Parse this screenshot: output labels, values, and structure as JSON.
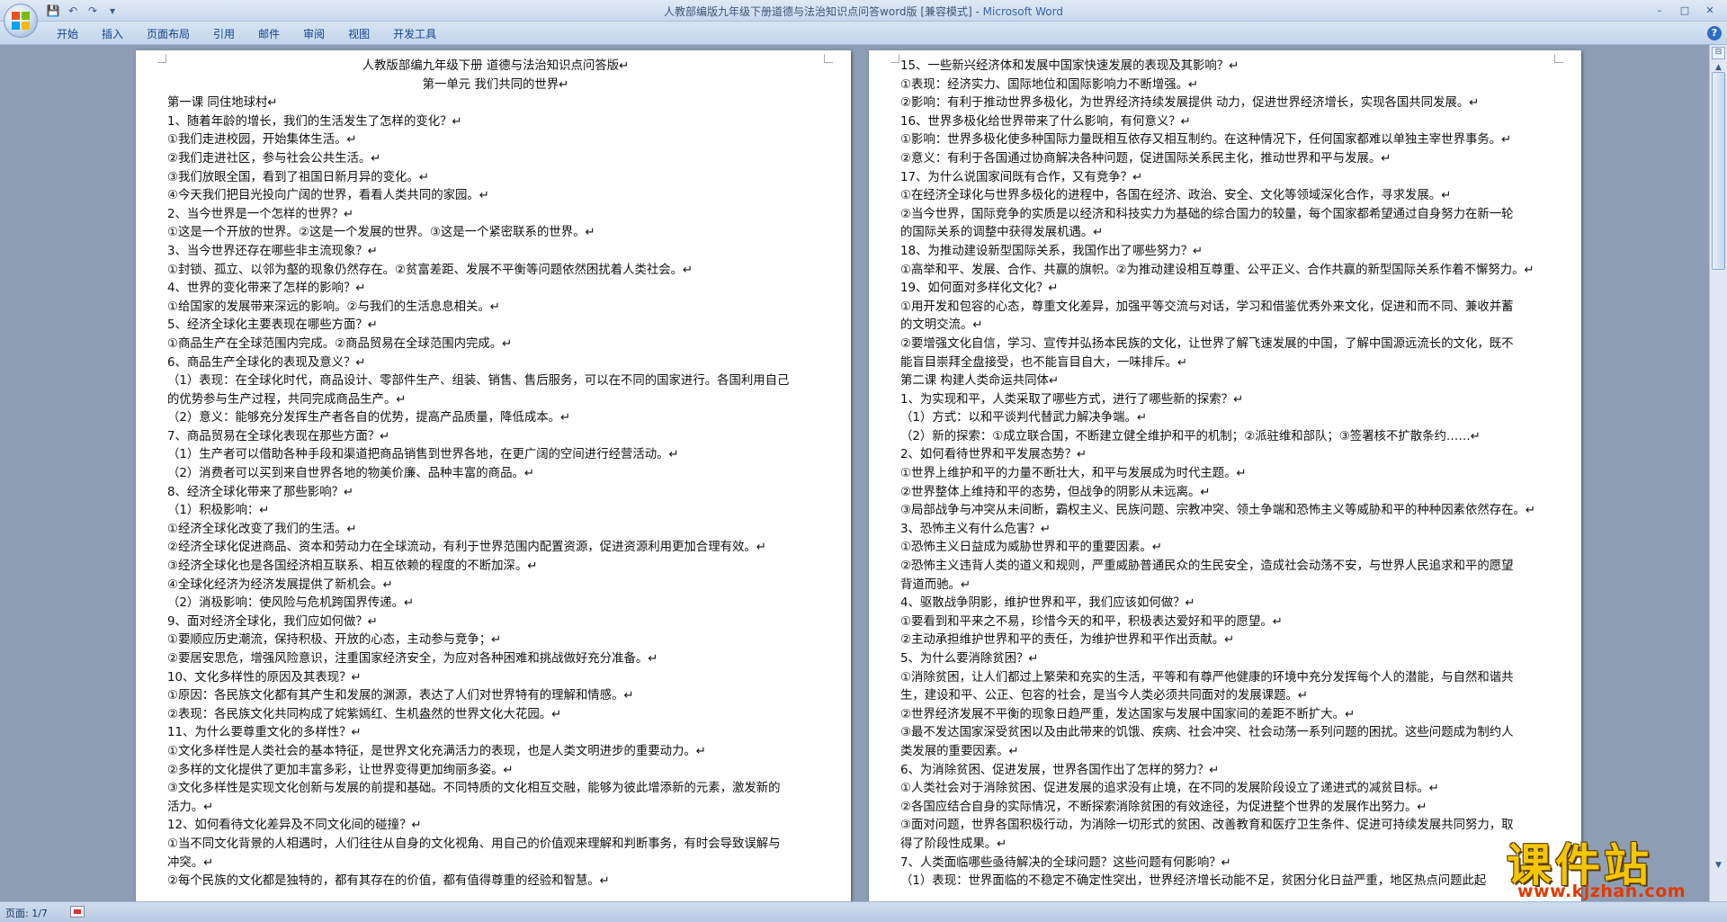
{
  "window": {
    "title": "人教部编版九年级下册道德与法治知识点问答word版 [兼容模式] - ",
    "app_name": "Microsoft Word",
    "minimize": "–",
    "maximize": "□",
    "close": "✕"
  },
  "qat": {
    "save": "💾",
    "undo": "↶",
    "redo": "↷",
    "customize": "▾"
  },
  "ribbon": {
    "tabs": [
      "开始",
      "插入",
      "页面布局",
      "引用",
      "邮件",
      "审阅",
      "视图",
      "开发工具"
    ],
    "help": "?"
  },
  "pages": {
    "left": [
      {
        "t": "人教版部编九年级下册 道德与法治知识点问答版↵",
        "c": true
      },
      {
        "t": "第一单元    我们共同的世界↵",
        "c": true
      },
      {
        "t": "第一课  同住地球村↵"
      },
      {
        "t": "1、随着年龄的增长，我们的生活发生了怎样的变化？↵"
      },
      {
        "t": "①我们走进校园，开始集体生活。↵"
      },
      {
        "t": "②我们走进社区，参与社会公共生活。↵"
      },
      {
        "t": "③我们放眼全国，看到了祖国日新月异的变化。↵"
      },
      {
        "t": "④今天我们把目光投向广阔的世界，看看人类共同的家园。↵"
      },
      {
        "t": "2、当今世界是一个怎样的世界？↵"
      },
      {
        "t": "①这是一个开放的世界。②这是一个发展的世界。③这是一个紧密联系的世界。↵"
      },
      {
        "t": "3、当今世界还存在哪些非主流现象？↵"
      },
      {
        "t": "①封锁、孤立、以邻为壑的现象仍然存在。②贫富差距、发展不平衡等问题依然困扰着人类社会。↵"
      },
      {
        "t": "4、世界的变化带来了怎样的影响？↵"
      },
      {
        "t": "①给国家的发展带来深远的影响。②与我们的生活息息相关。↵"
      },
      {
        "t": "5、经济全球化主要表现在哪些方面？↵"
      },
      {
        "t": "①商品生产在全球范围内完成。②商品贸易在全球范围内完成。↵"
      },
      {
        "t": "6、商品生产全球化的表现及意义？↵"
      },
      {
        "t": "（1）表现：在全球化时代，商品设计、零部件生产、组装、销售、售后服务，可以在不同的国家进行。各国利用自己"
      },
      {
        "t": "的优势参与生产过程，共同完成商品生产。↵"
      },
      {
        "t": "（2）意义：能够充分发挥生产者各自的优势，提高产品质量，降低成本。↵"
      },
      {
        "t": "7、商品贸易在全球化表现在那些方面？↵"
      },
      {
        "t": "（1）生产者可以借助各种手段和渠道把商品销售到世界各地，在更广阔的空间进行经营活动。↵"
      },
      {
        "t": "（2）消费者可以买到来自世界各地的物美价廉、品种丰富的商品。↵"
      },
      {
        "t": "8、经济全球化带来了那些影响？↵"
      },
      {
        "t": "（1）积极影响：↵"
      },
      {
        "t": "①经济全球化改变了我们的生活。↵"
      },
      {
        "t": "②经济全球化促进商品、资本和劳动力在全球流动，有利于世界范围内配置资源，促进资源利用更加合理有效。↵"
      },
      {
        "t": "③经济全球化也是各国经济相互联系、相互依赖的程度的不断加深。↵"
      },
      {
        "t": "④全球化经济为经济发展提供了新机会。↵"
      },
      {
        "t": "（2）消极影响：使风险与危机跨国界传递。↵"
      },
      {
        "t": "9、面对经济全球化，我们应如何做？↵"
      },
      {
        "t": "①要顺应历史潮流，保持积极、开放的心态，主动参与竞争；↵"
      },
      {
        "t": "②要居安思危，增强风险意识，注重国家经济安全，为应对各种困难和挑战做好充分准备。↵"
      },
      {
        "t": "10、文化多样性的原因及其表现？↵"
      },
      {
        "t": "①原因：各民族文化都有其产生和发展的渊源，表达了人们对世界特有的理解和情感。↵"
      },
      {
        "t": "②表现：各民族文化共同构成了姹紫嫣红、生机盎然的世界文化大花园。↵"
      },
      {
        "t": "11、为什么要尊重文化的多样性？↵"
      },
      {
        "t": "①文化多样性是人类社会的基本特征，是世界文化充满活力的表现，也是人类文明进步的重要动力。↵"
      },
      {
        "t": "②多样的文化提供了更加丰富多彩，让世界变得更加绚丽多姿。↵"
      },
      {
        "t": "③文化多样性是实现文化创新与发展的前提和基础。不同特质的文化相互交融，能够为彼此增添新的元素，激发新的"
      },
      {
        "t": "活力。↵"
      },
      {
        "t": "12、如何看待文化差异及不同文化间的碰撞？↵"
      },
      {
        "t": "①当不同文化背景的人相遇时，人们往往从自身的文化视角、用自己的价值观来理解和判断事务，有时会导致误解与"
      },
      {
        "t": "冲突。↵"
      },
      {
        "t": "②每个民族的文化都是独特的，都有其存在的价值，都有值得尊重的经验和智慧。↵"
      }
    ],
    "right": [
      {
        "t": "15、一些新兴经济体和发展中国家快速发展的表现及其影响？↵"
      },
      {
        "t": "①表现：经济实力、国际地位和国际影响力不断增强。↵"
      },
      {
        "t": "②影响：有利于推动世界多极化，为世界经济持续发展提供 动力，促进世界经济增长，实现各国共同发展。↵"
      },
      {
        "t": "16、世界多极化给世界带来了什么影响，有何意义？↵"
      },
      {
        "t": "①影响：世界多极化使多种国际力量既相互依存又相互制约。在这种情况下，任何国家都难以单独主宰世界事务。↵"
      },
      {
        "t": "②意义：有利于各国通过协商解决各种问题，促进国际关系民主化，推动世界和平与发展。↵"
      },
      {
        "t": "17、为什么说国家间既有合作，又有竞争？↵"
      },
      {
        "t": "①在经济全球化与世界多极化的进程中，各国在经济、政治、安全、文化等领域深化合作，寻求发展。↵"
      },
      {
        "t": "②当今世界，国际竞争的实质是以经济和科技实力为基础的综合国力的较量，每个国家都希望通过自身努力在新一轮"
      },
      {
        "t": "的国际关系的调整中获得发展机遇。↵"
      },
      {
        "t": "18、为推动建设新型国际关系，我国作出了哪些努力？↵"
      },
      {
        "t": "①高举和平、发展、合作、共赢的旗帜。②为推动建设相互尊重、公平正义、合作共赢的新型国际关系作着不懈努力。↵"
      },
      {
        "t": "19、如何面对多样化文化？↵"
      },
      {
        "t": "①用开发和包容的心态，尊重文化差异，加强平等交流与对话，学习和借鉴优秀外来文化，促进和而不同、兼收并蓄"
      },
      {
        "t": "的文明交流。↵"
      },
      {
        "t": "②要增强文化自信，学习、宣传并弘扬本民族的文化，让世界了解飞速发展的中国，了解中国源远流长的文化，既不"
      },
      {
        "t": "能盲目崇拜全盘接受，也不能盲目自大，一味排斥。↵"
      },
      {
        "t": "第二课  构建人类命运共同体↵"
      },
      {
        "t": "1、为实现和平，人类采取了哪些方式，进行了哪些新的探索？↵"
      },
      {
        "t": "（1）方式：以和平谈判代替武力解决争端。↵"
      },
      {
        "t": "（2）新的探索：①成立联合国，不断建立健全维护和平的机制；②派驻维和部队；③签署核不扩散条约……↵"
      },
      {
        "t": "2、如何看待世界和平发展态势？↵"
      },
      {
        "t": "①世界上维护和平的力量不断壮大，和平与发展成为时代主题。↵"
      },
      {
        "t": "②世界整体上维持和平的态势，但战争的阴影从未远离。↵"
      },
      {
        "t": "③局部战争与冲突从未间断，霸权主义、民族问题、宗教冲突、领土争端和恐怖主义等威胁和平的种种因素依然存在。↵"
      },
      {
        "t": "3、恐怖主义有什么危害？↵"
      },
      {
        "t": "①恐怖主义日益成为威胁世界和平的重要因素。↵"
      },
      {
        "t": "②恐怖主义违背人类的道义和规则，严重威胁普通民众的生民安全，造成社会动荡不安，与世界人民追求和平的愿望"
      },
      {
        "t": "背道而驰。↵"
      },
      {
        "t": "4、驱散战争阴影，维护世界和平，我们应该如何做？↵"
      },
      {
        "t": "①要看到和平来之不易，珍惜今天的和平，积极表达爱好和平的愿望。↵"
      },
      {
        "t": "②主动承担维护世界和平的责任，为维护世界和平作出贡献。↵"
      },
      {
        "t": "5、为什么要消除贫困？↵"
      },
      {
        "t": "①消除贫困，让人们都过上繁荣和充实的生活，平等和有尊严他健康的环境中充分发挥每个人的潜能，与自然和谐共"
      },
      {
        "t": "生，建设和平、公正、包容的社会，是当今人类必须共同面对的发展课题。↵"
      },
      {
        "t": "②世界经济发展不平衡的现象日趋严重，发达国家与发展中国家间的差距不断扩大。↵"
      },
      {
        "t": "③最不发达国家深受贫困以及由此带来的饥饿、疾病、社会冲突、社会动荡一系列问题的困扰。这些问题成为制约人"
      },
      {
        "t": "类发展的重要因素。↵"
      },
      {
        "t": "6、为消除贫困、促进发展，世界各国作出了怎样的努力？↵"
      },
      {
        "t": "①人类社会对于消除贫困、促进发展的追求没有止境，在不同的发展阶段设立了递进式的减贫目标。↵"
      },
      {
        "t": "②各国应结合自身的实际情况，不断探索消除贫困的有效途径，为促进整个世界的发展作出努力。↵"
      },
      {
        "t": "③面对问题，世界各国积极行动，为消除一切形式的贫困、改善教育和医疗卫生条件、促进可持续发展共同努力，取"
      },
      {
        "t": "得了阶段性成果。↵"
      },
      {
        "t": "7、人类面临哪些亟待解决的全球问题？这些问题有何影响？↵"
      },
      {
        "t": "（1）表现：世界面临的不稳定不确定性突出，世界经济增长动能不足，贫困分化日益严重，地区热点问题此起"
      }
    ]
  },
  "statusbar": {
    "page_info": "页面: 1/7"
  },
  "watermark": {
    "brand": "课件站",
    "url": "www.kjzhan.com"
  }
}
